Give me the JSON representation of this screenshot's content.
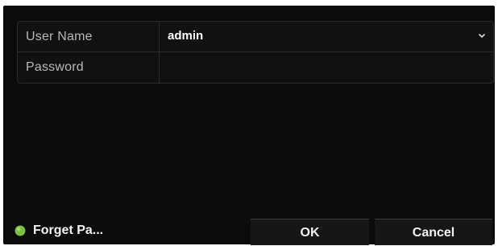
{
  "login": {
    "username_label": "User Name",
    "username_value": "admin",
    "password_label": "Password",
    "password_value": ""
  },
  "footer": {
    "forget_label": "Forget Pa...",
    "ok_label": "OK",
    "cancel_label": "Cancel"
  },
  "colors": {
    "dialog_bg": "#0b0b0b",
    "accent_dot": "#7ac142"
  },
  "icons": {
    "select_arrow": "chevron-down-icon",
    "forget_indicator": "green-dot-icon"
  }
}
